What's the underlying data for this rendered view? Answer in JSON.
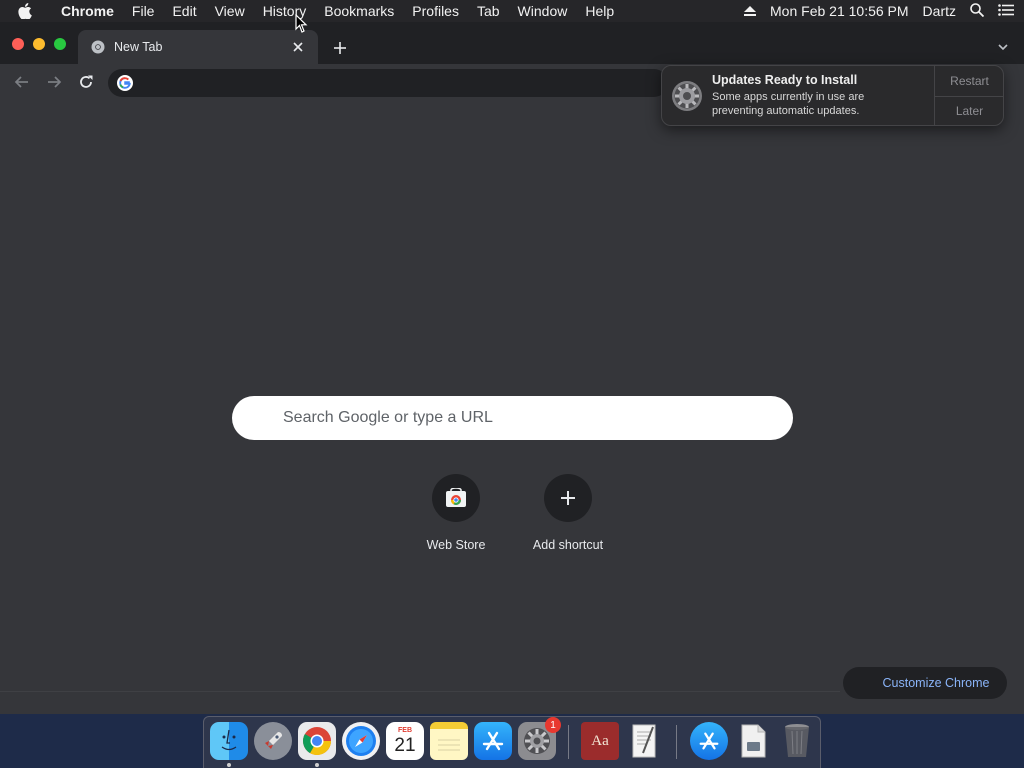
{
  "menubar": {
    "app_name": "Chrome",
    "menus": [
      "File",
      "Edit",
      "View",
      "History",
      "Bookmarks",
      "Profiles",
      "Tab",
      "Window",
      "Help"
    ],
    "clock": "Mon Feb 21  10:56 PM",
    "user": "Dartz",
    "icons": [
      "apple-icon",
      "eject-icon",
      "spotlight-search-icon",
      "control-center-icon"
    ]
  },
  "tab": {
    "title": "New Tab",
    "favicon": "chrome-icon",
    "close_icon": "close-icon",
    "new_tab_icon": "plus-icon"
  },
  "toolbar": {
    "back_icon": "back-arrow-icon",
    "forward_icon": "forward-arrow-icon",
    "reload_icon": "reload-icon",
    "omnibox_value": "",
    "omnibox_icon": "google-g-icon"
  },
  "ntp": {
    "search_placeholder": "Search Google or type a URL",
    "shortcuts": [
      {
        "label": "Web Store",
        "icon": "web-store-icon"
      },
      {
        "label": "Add shortcut",
        "icon": "plus-icon"
      }
    ],
    "customize_label": "Customize Chrome"
  },
  "notification": {
    "icon": "system-preferences-gear-icon",
    "title": "Updates Ready to Install",
    "body": "Some apps currently in use are preventing automatic updates.",
    "actions": [
      "Restart",
      "Later"
    ]
  },
  "dock": {
    "items": [
      {
        "name": "finder",
        "running": true
      },
      {
        "name": "launchpad",
        "running": false
      },
      {
        "name": "chrome",
        "running": true
      },
      {
        "name": "safari",
        "running": false
      },
      {
        "name": "calendar",
        "running": false,
        "month": "FEB",
        "day": "21"
      },
      {
        "name": "notes",
        "running": false
      },
      {
        "name": "app-store",
        "running": false
      },
      {
        "name": "system-preferences",
        "running": false,
        "badge": "1"
      },
      {
        "name": "dictionary",
        "running": false,
        "glyph": "Aa"
      },
      {
        "name": "textedit",
        "running": false
      },
      {
        "name": "app-store-downloads",
        "running": false
      },
      {
        "name": "preview-file",
        "running": false
      },
      {
        "name": "trash",
        "running": false
      }
    ]
  },
  "colors": {
    "page_bg": "#35363a",
    "tabstrip_bg": "#202124",
    "accent_link": "#8ab4f8",
    "desktop_bg": "#1e2b49"
  }
}
